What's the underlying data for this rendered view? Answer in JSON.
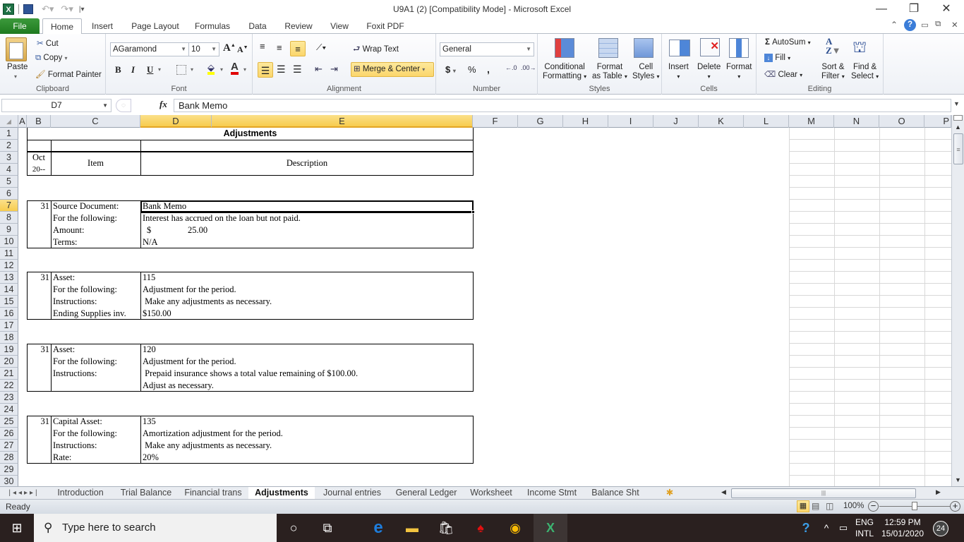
{
  "window": {
    "title": "U9A1 (2)  [Compatibility Mode]  -  Microsoft Excel",
    "minimize": "—",
    "restore": "❐",
    "close": "✕"
  },
  "ribbon_tabs": [
    {
      "label": "File"
    },
    {
      "label": "Home"
    },
    {
      "label": "Insert"
    },
    {
      "label": "Page Layout"
    },
    {
      "label": "Formulas"
    },
    {
      "label": "Data"
    },
    {
      "label": "Review"
    },
    {
      "label": "View"
    },
    {
      "label": "Foxit PDF"
    }
  ],
  "ribbon": {
    "clipboard": {
      "paste": "Paste",
      "cut": "Cut",
      "copy": "Copy",
      "format_painter": "Format Painter",
      "label": "Clipboard"
    },
    "font": {
      "name": "AGaramond",
      "size": "10",
      "bold": "B",
      "italic": "I",
      "underline": "U",
      "label": "Font"
    },
    "alignment": {
      "wrap_text": "Wrap Text",
      "merge_center": "Merge & Center",
      "label": "Alignment"
    },
    "number": {
      "format": "General",
      "currency": "$",
      "percent": "%",
      "comma": ",",
      "label": "Number"
    },
    "styles": {
      "conditional": "Conditional",
      "conditional2": "Formatting",
      "format_table": "Format",
      "format_table2": "as Table",
      "cell_styles": "Cell",
      "cell_styles2": "Styles",
      "label": "Styles"
    },
    "cells": {
      "insert": "Insert",
      "delete": "Delete",
      "format": "Format",
      "label": "Cells"
    },
    "editing": {
      "autosum": "AutoSum",
      "fill": "Fill",
      "clear": "Clear",
      "sort": "Sort &",
      "sort2": "Filter",
      "find": "Find &",
      "find2": "Select",
      "label": "Editing"
    }
  },
  "formula_bar": {
    "name_box": "D7",
    "fx": "fx",
    "content": "Bank Memo"
  },
  "columns": [
    "A",
    "B",
    "C",
    "D",
    "E",
    "F",
    "G",
    "H",
    "I",
    "J",
    "K",
    "L",
    "M",
    "N",
    "O",
    "P"
  ],
  "rows": [
    "1",
    "2",
    "3",
    "4",
    "5",
    "6",
    "7",
    "8",
    "9",
    "10",
    "11",
    "12",
    "13",
    "14",
    "15",
    "16",
    "17",
    "18",
    "19",
    "20",
    "21",
    "22",
    "23",
    "24",
    "25",
    "26",
    "27",
    "28",
    "29",
    "30"
  ],
  "sheet": {
    "title": "Adjustments",
    "header": {
      "date_month": "Oct",
      "date_year": "20--",
      "item": "Item",
      "description": "Description"
    },
    "blocks": [
      {
        "day": "31",
        "rows": [
          {
            "label": "Source Document:",
            "value": "Bank Memo"
          },
          {
            "label": "For the following:",
            "value": "Interest has accrued on the loan but not paid."
          },
          {
            "label": "Amount:",
            "value": "$",
            "value2": "25.00"
          },
          {
            "label": "Terms:",
            "value": "N/A"
          }
        ]
      },
      {
        "day": "31",
        "rows": [
          {
            "label": "Asset:",
            "value": "115"
          },
          {
            "label": "For the following:",
            "value": "Adjustment for the period."
          },
          {
            "label": "Instructions:",
            "value": " Make any adjustments as necessary."
          },
          {
            "label": "Ending Supplies inv.",
            "value": "$150.00"
          }
        ]
      },
      {
        "day": "31",
        "rows": [
          {
            "label": "Asset:",
            "value": "120"
          },
          {
            "label": "For the following:",
            "value": "Adjustment for the period."
          },
          {
            "label": "Instructions:",
            "value": " Prepaid insurance shows a total value remaining of $100.00."
          },
          {
            "label": "",
            "value": "Adjust as necessary."
          }
        ]
      },
      {
        "day": "31",
        "rows": [
          {
            "label": "Capital Asset:",
            "value": "135"
          },
          {
            "label": "For the following:",
            "value": "Amortization adjustment for the period."
          },
          {
            "label": "Instructions:",
            "value": " Make any adjustments as necessary."
          },
          {
            "label": "Rate:",
            "value": "20%"
          }
        ]
      }
    ]
  },
  "sheet_tabs": [
    "Introduction",
    "Trial Balance",
    "Financial trans",
    "Adjustments",
    "Journal  entries",
    "General Ledger",
    "Worksheet",
    "Income Stmt",
    "Balance Sht"
  ],
  "active_sheet": "Adjustments",
  "status": {
    "ready": "Ready",
    "zoom": "100%"
  },
  "taskbar": {
    "search_placeholder": "Type here to search",
    "lang1": "ENG",
    "lang2": "INTL",
    "time": "12:59 PM",
    "date": "15/01/2020",
    "notifications": "24"
  }
}
